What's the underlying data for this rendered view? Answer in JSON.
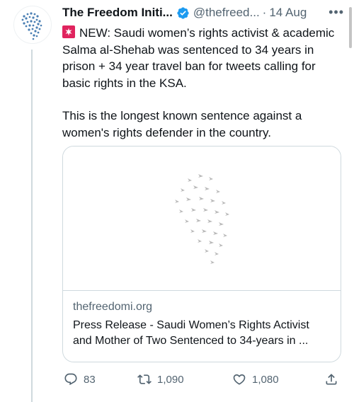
{
  "tweet": {
    "author_name": "The Freedom Initi...",
    "handle": "@thefreed...",
    "separator": "·",
    "timestamp": "14 Aug",
    "paragraph1": "NEW: Saudi women’s rights activist & academic Salma al-Shehab was sentenced to 34 years in prison + 34 year travel ban for tweets calling for basic rights in the KSA.",
    "paragraph2": "This is the longest known sentence against a women's rights defender in the country.",
    "verified": true
  },
  "card": {
    "domain": "thefreedomi.org",
    "title": "Press Release - Saudi Women’s Rights Activist and Mother of Two Sentenced to 34-years in ..."
  },
  "actions": {
    "replies": "83",
    "retweets": "1,090",
    "likes": "1,080"
  },
  "icons": {
    "more": "more-icon",
    "verified": "verified-badge-icon",
    "siren": "siren-emoji-icon",
    "reply": "reply-icon",
    "retweet": "retweet-icon",
    "like": "heart-icon",
    "share": "share-icon"
  },
  "colors": {
    "text": "#0f1419",
    "secondary": "#536471",
    "verified": "#1d9bf0",
    "border": "#cfd9de"
  }
}
